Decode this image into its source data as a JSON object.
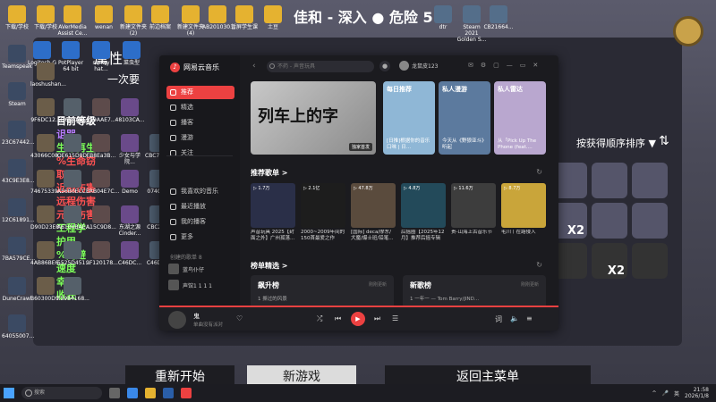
{
  "desktop": {
    "icons_top": [
      "下载/学校",
      "下载/学校",
      "AVerMedia Assist Ce...",
      "wenan",
      "新建文件夹 (2)",
      "前边档案",
      "新建文件夹 (4)",
      "AB201030...",
      "暂屏学生课",
      "土豆"
    ],
    "icons_top_right": [
      "dtr",
      "Steam 2021 Golden S...",
      "CB21664..."
    ],
    "icons_col2": [
      "Logitech G HUB",
      "PotPlayer 64 bit",
      "sentry hat...",
      "菜虫型"
    ],
    "icons_left": [
      "Teamspeak",
      "Steam",
      "23C67442...",
      "43C9E3E8...",
      "12C61891...",
      "7BA579CE...",
      "DuneCrawl",
      "64055007..."
    ],
    "icons_mid": [
      "laoshushan...",
      "9F6DC12...",
      "43066C08...",
      "74675339...",
      "D90D23E8...",
      "4AB86BE6...",
      "B60300D9..."
    ],
    "icons_col3": [
      "5D6B4AAE...",
      "OE615D8D...",
      "A56B0ECC...",
      "A6104BAE...",
      "5525D451...",
      "F5984168..."
    ],
    "icons_col4": [
      "759AAE7...",
      "FB8Ea3B...",
      "ERB04E7C...",
      "A15C9D8...",
      "9F120178..."
    ],
    "icons_col5": [
      "48103CA...",
      "少女与学院...",
      "Demo",
      "东湖之源 Cinder...",
      "C46DC..."
    ],
    "icons_col6": [
      "CBC7C9...",
      "074C6...",
      "CBC24...",
      "C46DC..."
    ]
  },
  "game": {
    "title": "佳和 - 深入 ● 危险 5",
    "prop_title": "属性",
    "prop_sub": "一次要",
    "side_stats": [
      "目前等级",
      "诅咒",
      "生命再生",
      "%生命窃取",
      "近战伤害",
      "远程伤害",
      "元素伤害",
      "工程学",
      "护甲",
      "%闪避",
      "速度",
      "幸运",
      "收获"
    ],
    "sort_label": "按获得顺序排序",
    "sort_dropdown_icon": "▼",
    "sort_toggle_icon": "⇅",
    "items": [
      {
        "label": ""
      },
      {
        "label": ""
      },
      {
        "label": ""
      },
      {
        "label": "X2"
      },
      {
        "label": ""
      },
      {
        "label": ""
      },
      {
        "label": ""
      },
      {
        "label": "X2"
      },
      {
        "label": ""
      }
    ],
    "buttons": {
      "restart": "重新开始",
      "new_game": "新游戏",
      "main_menu": "返回主菜单"
    }
  },
  "app": {
    "name": "网易云音乐",
    "nav": [
      {
        "label": "推荐",
        "active": true
      },
      {
        "label": "精选",
        "active": false
      },
      {
        "label": "播客",
        "active": false
      },
      {
        "label": "漫游",
        "active": false
      },
      {
        "label": "关注",
        "active": false
      }
    ],
    "my_nav": [
      {
        "label": "我喜欢的音乐"
      },
      {
        "label": "最近播放"
      },
      {
        "label": "我的播客"
      },
      {
        "label": "更多"
      }
    ],
    "playlist_section": "创建的歌单 8",
    "playlists": [
      {
        "name": "蓝鸟仆仔"
      },
      {
        "name": "声馆1 1 1 1"
      }
    ],
    "search_placeholder": "不药 - 声音玩具",
    "user_name": "龙鼠皮123",
    "top_icons": [
      "✉",
      "⚙",
      "▢",
      "—",
      "▭",
      "✕"
    ],
    "banner": {
      "text": "列车上的字",
      "tag": "独家首发"
    },
    "cards": [
      {
        "label": "每日推荐",
        "desc": "[日推]根据你的音乐口味 | 日...",
        "color": "#8fb7d6"
      },
      {
        "label": "私人漫游",
        "desc": "今天从《野狼亚斗》听起",
        "color": "#5c7a9e"
      },
      {
        "label": "私人雷达",
        "desc": "从「Pick Up The Phone (feat....",
        "color": "#b9a7cf"
      }
    ],
    "section_playlist_title": "推荐歌单 >",
    "recommend": [
      {
        "count": "▷ 1.7万",
        "name": "声音玩具 2025【封面之外】广州孤落...",
        "color": "#2a2f48"
      },
      {
        "count": "▷ 2.1亿",
        "name": "2000~2009年间的150首最爱之作",
        "color": "#1d1d1d"
      },
      {
        "count": "▷ 47.8万",
        "name": "[国际] deca/摩东/犬魔/爆士班/铅笔...",
        "color": "#5a4b3d"
      },
      {
        "count": "▷ 4.8万",
        "name": "后摇圈【2025年12月】推荐后摇专辑",
        "color": "#234a5a"
      },
      {
        "count": "▷ 11.6万",
        "name": "贵-山海上古音乐节",
        "color": "#3d3d3d"
      },
      {
        "count": "▷ 8.7万",
        "name": "毛川丨在路侵入",
        "color": "#c9a53a"
      }
    ],
    "section_rank_title": "榜单精选 >",
    "ranks": [
      {
        "title": "飙升榜",
        "meta": "刚刚更新",
        "row": "1 撕过的风景  "
      },
      {
        "title": "新歌榜",
        "meta": "刚刚更新",
        "row": "1 一年一 — Tom Barry/JIND..."
      }
    ],
    "player": {
      "song": "鬼",
      "sub": "单曲没有派对"
    }
  },
  "taskbar": {
    "search": "搜索",
    "lang": "英",
    "time": "21:58",
    "date": "2026/1/8"
  }
}
